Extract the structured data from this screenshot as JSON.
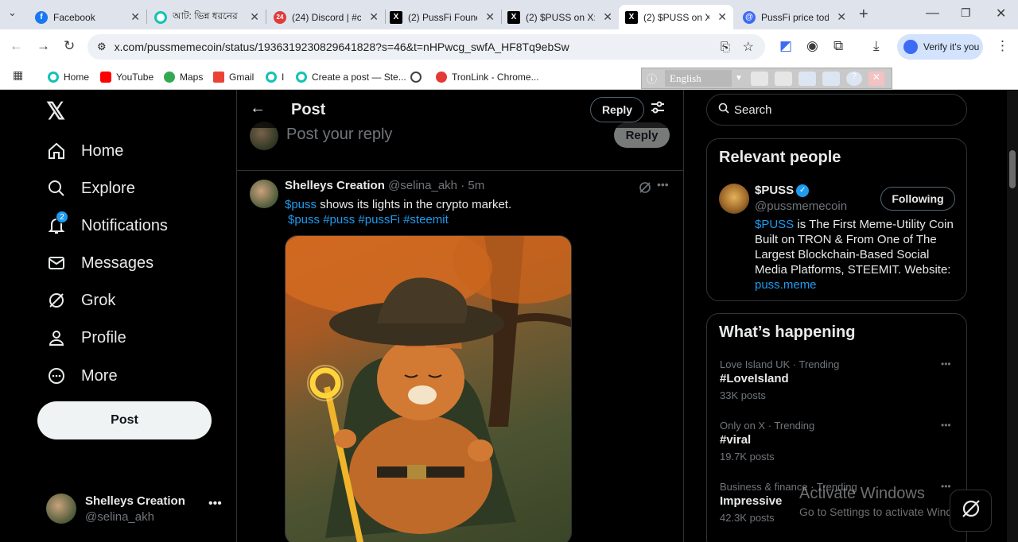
{
  "browser": {
    "tabs": [
      {
        "title": "Facebook",
        "icon": "facebook-icon",
        "color": "#1877f2",
        "glyph": "f"
      },
      {
        "title": "আট: ভিন্ন ধরনের",
        "icon": "site-icon",
        "color": "#12c3b5",
        "glyph": ""
      },
      {
        "title": "(24) Discord | #c",
        "icon": "discord-icon",
        "color": "#e03c3c",
        "glyph": "24"
      },
      {
        "title": "(2) PussFi Found",
        "icon": "x-icon",
        "color": "#000000",
        "glyph": "X"
      },
      {
        "title": "(2) $PUSS on X:",
        "icon": "x-icon",
        "color": "#000000",
        "glyph": "X"
      },
      {
        "title": "(2) $PUSS on X:",
        "icon": "x-icon",
        "color": "#000000",
        "glyph": "X"
      },
      {
        "title": "PussFi price tod",
        "icon": "coingecko-icon",
        "color": "#3d6bf5",
        "glyph": "@"
      }
    ],
    "url": "x.com/pussmemecoin/status/1936319230829641828?s=46&t=nHPwcg_swfA_HF8Tq9ebSw",
    "verify_label": "Verify it's you",
    "bookmarks": [
      {
        "label": "Home",
        "color": "#12c3b5"
      },
      {
        "label": "YouTube",
        "color": "#ff0000"
      },
      {
        "label": "Maps",
        "color": "#34a853"
      },
      {
        "label": "Gmail",
        "color": "#ea4335"
      },
      {
        "label": "I",
        "color": "#12c3b5"
      },
      {
        "label": "Create a post — Ste...",
        "color": "#12c3b5"
      },
      {
        "label": "",
        "color": "#444444"
      },
      {
        "label": "TronLink - Chrome...",
        "color": "#e53935"
      }
    ],
    "translate_lang": "English"
  },
  "nav": {
    "items": [
      {
        "label": "Home",
        "icon": "home-icon"
      },
      {
        "label": "Explore",
        "icon": "search-icon"
      },
      {
        "label": "Notifications",
        "icon": "bell-icon",
        "badge": "2"
      },
      {
        "label": "Messages",
        "icon": "mail-icon"
      },
      {
        "label": "Grok",
        "icon": "grok-icon"
      },
      {
        "label": "Profile",
        "icon": "person-icon"
      },
      {
        "label": "More",
        "icon": "more-circle-icon"
      }
    ],
    "post_label": "Post",
    "account": {
      "name": "Shelleys Creation",
      "handle": "@selina_akh"
    }
  },
  "main": {
    "header_title": "Post",
    "header_reply": "Reply",
    "reply_placeholder": "Post your reply",
    "reply_button": "Reply",
    "tweet": {
      "name": "Shelleys Creation",
      "handle": "@selina_akh",
      "time": "· 5m",
      "cashtag": "$puss",
      "text": " shows its lights in the crypto market.",
      "hashtags": "$puss #puss #pussFi #steemit"
    }
  },
  "sidebar": {
    "search_placeholder": "Search",
    "relevant_title": "Relevant people",
    "person": {
      "name": "$PUSS",
      "handle": "@pussmemecoin",
      "follow_label": "Following",
      "bio_link": "$PUSS",
      "bio": " is The First Meme-Utility Coin Built on TRON & From One of The Largest Blockchain-Based Social Media Platforms, STEEMIT. Website: ",
      "website": "puss.meme"
    },
    "happening_title": "What’s happening",
    "trends": [
      {
        "context": "Love Island UK · Trending",
        "title": "#LoveIsland",
        "count": "33K posts"
      },
      {
        "context": "Only on X · Trending",
        "title": "#viral",
        "count": "19.7K posts"
      },
      {
        "context": "Business & finance · Trending",
        "title": "Impressive",
        "count": "42.3K posts"
      }
    ]
  },
  "watermark": {
    "line1": "Activate Windows",
    "line2": "Go to Settings to activate Windows."
  },
  "colors": {
    "accent": "#1d9bf0",
    "bg": "#000000",
    "border": "#2f3336",
    "verified": "#1d9bf0"
  }
}
